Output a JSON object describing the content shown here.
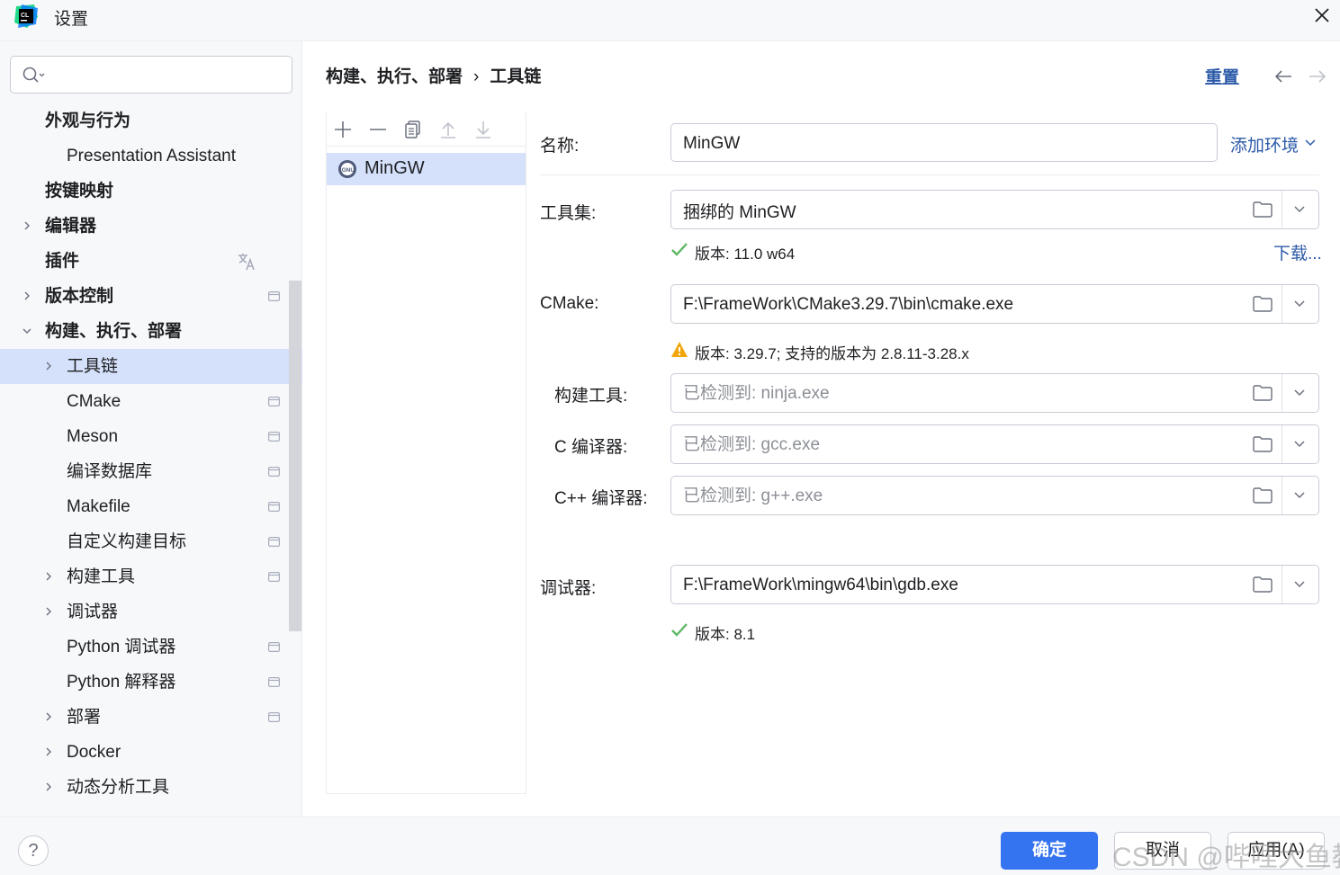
{
  "window": {
    "title": "设置",
    "logo_text": "CL"
  },
  "search": {
    "placeholder": "",
    "value": ""
  },
  "sidebar": {
    "items": [
      {
        "label": "外观与行为",
        "bold": true
      },
      {
        "label": "Presentation Assistant",
        "bold": false
      },
      {
        "label": "按键映射",
        "bold": true
      },
      {
        "label": "编辑器",
        "bold": true
      },
      {
        "label": "插件",
        "bold": true
      },
      {
        "label": "版本控制",
        "bold": true
      },
      {
        "label": "构建、执行、部署",
        "bold": true
      },
      {
        "label": "工具链",
        "bold": false,
        "selected": true
      },
      {
        "label": "CMake",
        "bold": false
      },
      {
        "label": "Meson",
        "bold": false
      },
      {
        "label": "编译数据库",
        "bold": false
      },
      {
        "label": "Makefile",
        "bold": false
      },
      {
        "label": "自定义构建目标",
        "bold": false
      },
      {
        "label": "构建工具",
        "bold": false
      },
      {
        "label": "调试器",
        "bold": false
      },
      {
        "label": "Python 调试器",
        "bold": false
      },
      {
        "label": "Python 解释器",
        "bold": false
      },
      {
        "label": "部署",
        "bold": false
      },
      {
        "label": "Docker",
        "bold": false
      },
      {
        "label": "动态分析工具",
        "bold": false
      }
    ]
  },
  "header": {
    "breadcrumb_parent": "构建、执行、部署",
    "breadcrumb_sep": "›",
    "breadcrumb_current": "工具链",
    "reset": "重置"
  },
  "toolchains": {
    "items": [
      "MinGW"
    ]
  },
  "form": {
    "name_label": "名称:",
    "name_value": "MinGW",
    "add_env": "添加环境",
    "toolset_label": "工具集:",
    "toolset_value": "捆绑的 MinGW",
    "toolset_status": "版本: 11.0 w64",
    "download": "下载...",
    "cmake_label": "CMake:",
    "cmake_value": "F:\\FrameWork\\CMake3.29.7\\bin\\cmake.exe",
    "cmake_status": "版本: 3.29.7; 支持的版本为 2.8.11-3.28.x",
    "build_tool_label": "构建工具:",
    "build_tool_placeholder": "已检测到: ninja.exe",
    "c_compiler_label": "C 编译器:",
    "c_compiler_placeholder": "已检测到: gcc.exe",
    "cpp_compiler_label": "C++ 编译器:",
    "cpp_compiler_placeholder": "已检测到: g++.exe",
    "debugger_label": "调试器:",
    "debugger_value": "F:\\FrameWork\\mingw64\\bin\\gdb.exe",
    "debugger_status": "版本: 8.1"
  },
  "footer": {
    "help": "?",
    "ok": "确定",
    "cancel": "取消",
    "apply": "应用(A)",
    "watermark": "CSDN @哔哩大鱼教"
  },
  "colors": {
    "accent": "#3574f0",
    "link": "#2c5aa8",
    "selection": "#d5e1fb",
    "ok_check": "#5fb865",
    "warning": "#f2a60c"
  }
}
